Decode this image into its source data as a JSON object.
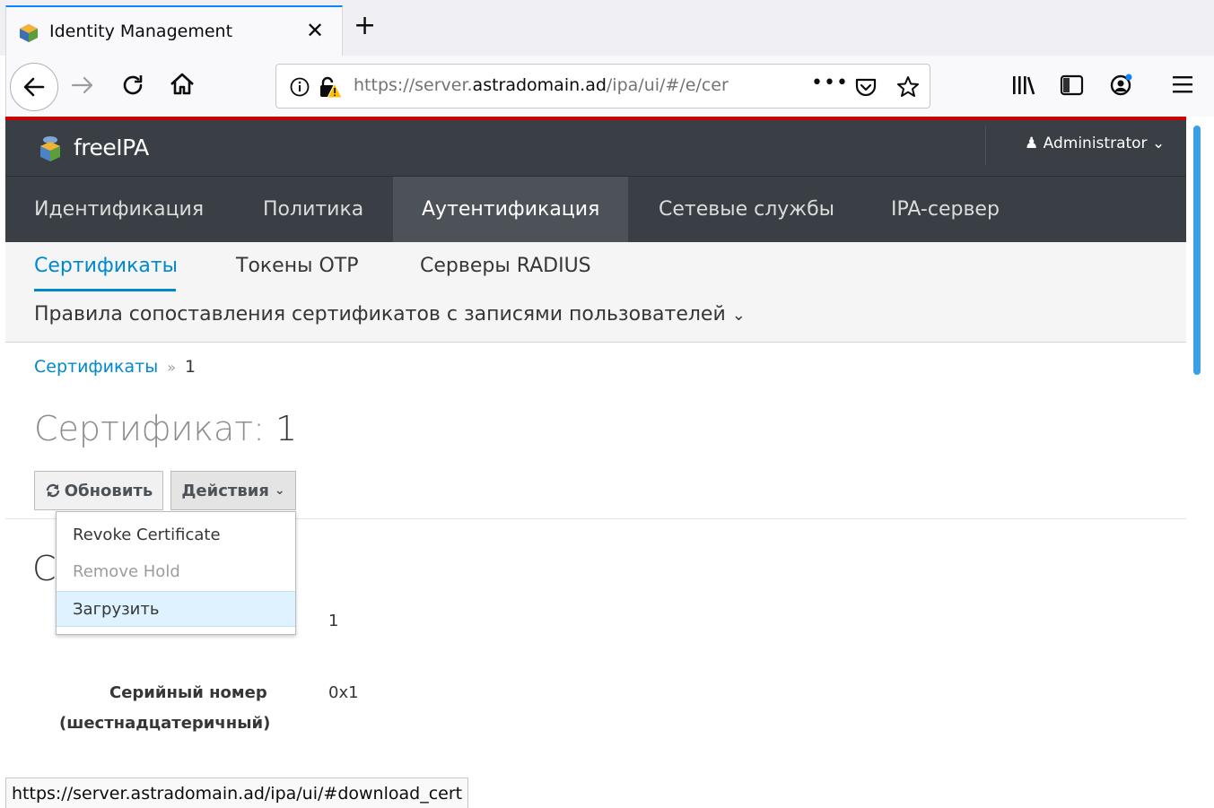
{
  "browser": {
    "tab_title": "Identity Management",
    "tab_close": "✕",
    "new_tab": "+",
    "url_host_prefix": "https://server.",
    "url_domain": "astradomain.ad",
    "url_path": "/ipa/ui/#/e/cer",
    "url_more": "•••",
    "status_url": "https://server.astradomain.ad/ipa/ui/#download_cert"
  },
  "header": {
    "brand": "freeIPA",
    "user": "Administrator"
  },
  "main_nav": [
    {
      "label": "Идентификация"
    },
    {
      "label": "Политика"
    },
    {
      "label": "Аутентификация"
    },
    {
      "label": "Сетевые службы"
    },
    {
      "label": "IPA-сервер"
    }
  ],
  "sub_nav": {
    "items": [
      {
        "label": "Сертификаты"
      },
      {
        "label": "Токены OTP"
      },
      {
        "label": "Серверы RADIUS"
      }
    ],
    "row2": "Правила сопоставления сертификатов с записями пользователей"
  },
  "breadcrumb": {
    "link": "Сертификаты",
    "separator": "»",
    "current": "1"
  },
  "page": {
    "title_prefix": "Сертификат:",
    "title_value": " 1",
    "refresh_label": "Обновить",
    "actions_label": "Действия",
    "partial_heading": "C"
  },
  "actions_menu": [
    {
      "label": "Revoke Certificate",
      "state": "enabled"
    },
    {
      "label": "Remove Hold",
      "state": "disabled"
    },
    {
      "label": "Загрузить",
      "state": "hover"
    }
  ],
  "details": {
    "value_1": "1",
    "serial_label_1": "Серийный номер",
    "serial_label_2": "(шестнадцатеричный)",
    "serial_value": "0x1"
  },
  "icons": {
    "back": "arrow-left-icon",
    "forward": "arrow-right-icon",
    "reload": "reload-icon",
    "home": "home-icon",
    "info": "info-icon",
    "lock": "insecure-lock-icon",
    "pocket": "pocket-icon",
    "bookmark": "star-icon",
    "library": "library-icon",
    "sidebar": "sidebar-icon",
    "account": "account-icon",
    "menu": "hamburger-menu-icon",
    "user": "user-icon",
    "refresh": "refresh-icon"
  },
  "colors": {
    "accent": "#0088ce",
    "masthead": "#393f44",
    "active_nav": "#4d5258",
    "alert_border": "#cc0000",
    "scroll": "#3ba0e6"
  }
}
